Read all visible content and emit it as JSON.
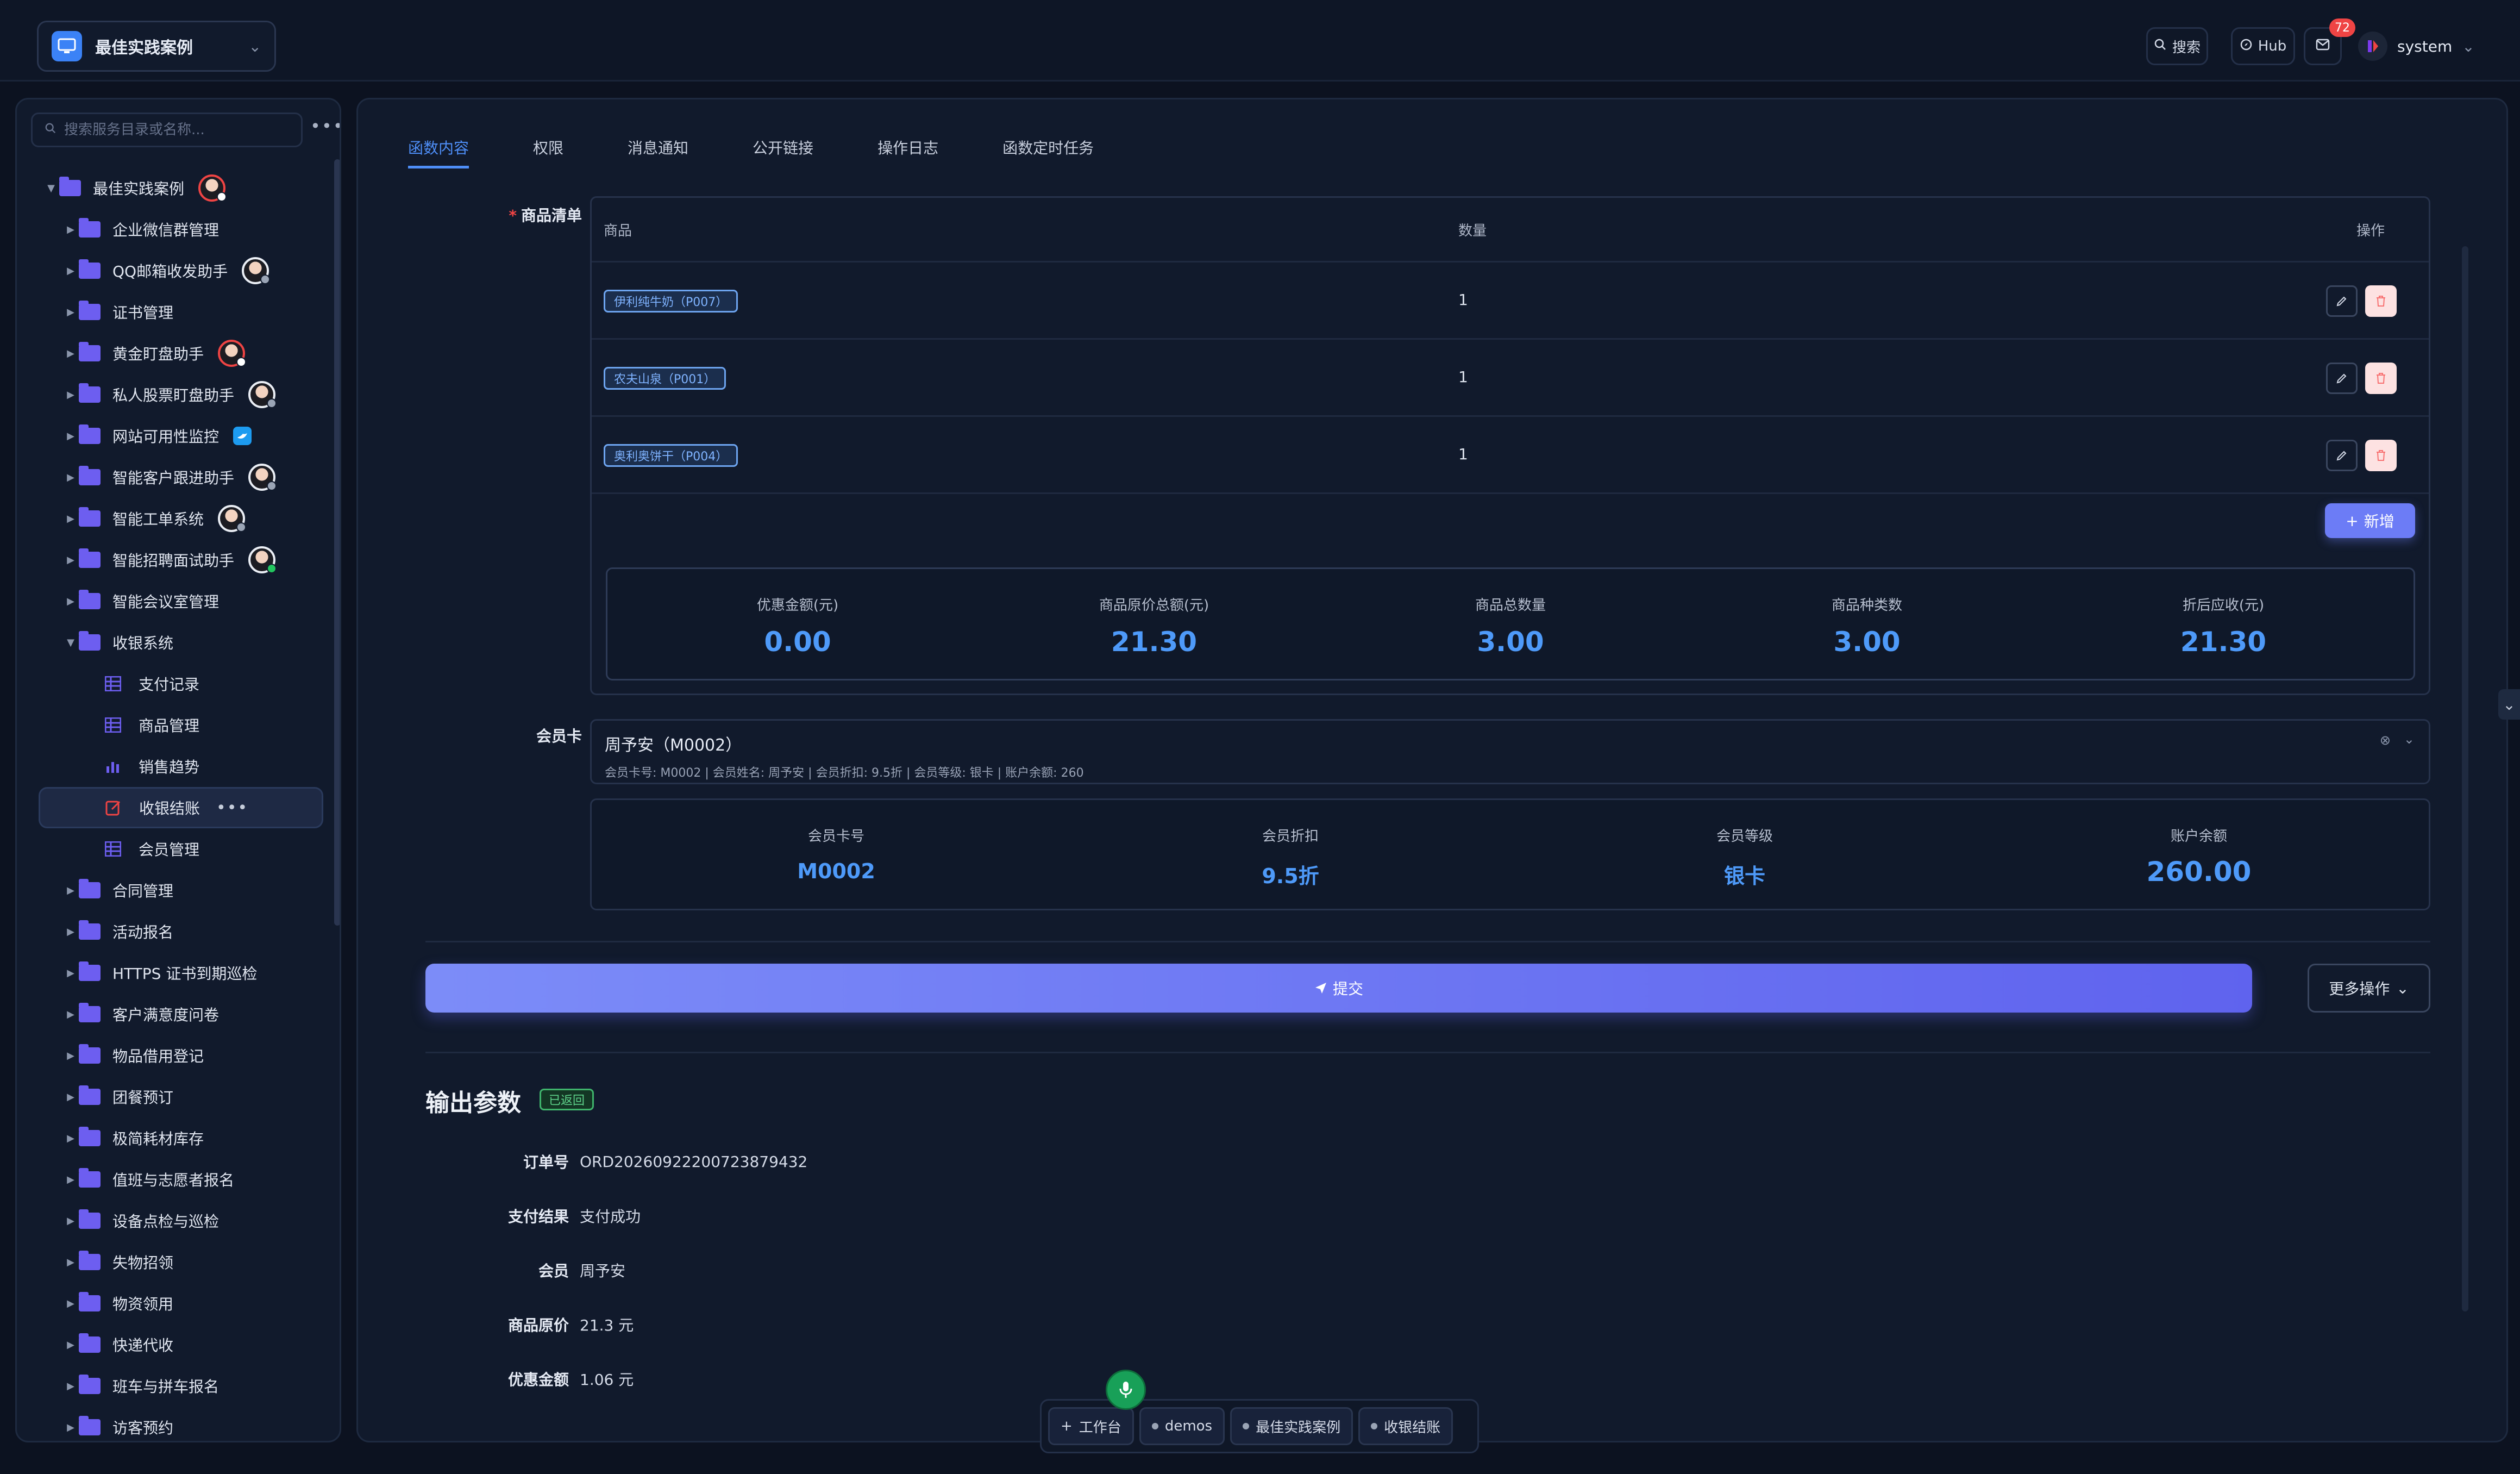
{
  "header": {
    "workspace_name": "最佳实践案例",
    "search_label": "搜索",
    "hub_label": "Hub",
    "notification_count": "72",
    "user_name": "system"
  },
  "sidebar": {
    "search_placeholder": "搜索服务目录或名称...",
    "root": "最佳实践案例",
    "items": [
      {
        "label": "企业微信群管理"
      },
      {
        "label": "QQ邮箱收发助手"
      },
      {
        "label": "证书管理"
      },
      {
        "label": "黄金盯盘助手"
      },
      {
        "label": "私人股票盯盘助手"
      },
      {
        "label": "网站可用性监控"
      },
      {
        "label": "智能客户跟进助手"
      },
      {
        "label": "智能工单系统"
      },
      {
        "label": "智能招聘面试助手"
      },
      {
        "label": "智能会议室管理"
      },
      {
        "label": "收银系统"
      }
    ],
    "children": [
      {
        "label": "支付记录"
      },
      {
        "label": "商品管理"
      },
      {
        "label": "销售趋势"
      },
      {
        "label": "收银结账"
      },
      {
        "label": "会员管理"
      }
    ],
    "items_after": [
      {
        "label": "合同管理"
      },
      {
        "label": "活动报名"
      },
      {
        "label": "HTTPS 证书到期巡检"
      },
      {
        "label": "客户满意度问卷"
      },
      {
        "label": "物品借用登记"
      },
      {
        "label": "团餐预订"
      },
      {
        "label": "极简耗材库存"
      },
      {
        "label": "值班与志愿者报名"
      },
      {
        "label": "设备点检与巡检"
      },
      {
        "label": "失物招领"
      },
      {
        "label": "物资领用"
      },
      {
        "label": "快递代收"
      },
      {
        "label": "班车与拼车报名"
      },
      {
        "label": "访客预约"
      }
    ]
  },
  "tabs": [
    "函数内容",
    "权限",
    "消息通知",
    "公开链接",
    "操作日志",
    "函数定时任务"
  ],
  "form": {
    "goods_label": "商品清单",
    "columns": [
      "商品",
      "数量",
      "操作"
    ],
    "rows": [
      {
        "product": "伊利纯牛奶（P007）",
        "qty": "1"
      },
      {
        "product": "农夫山泉（P001）",
        "qty": "1"
      },
      {
        "product": "奥利奥饼干（P004）",
        "qty": "1"
      }
    ],
    "add_label": "新增",
    "summary": [
      {
        "label": "优惠金额(元)",
        "value": "0.00"
      },
      {
        "label": "商品原价总额(元)",
        "value": "21.30"
      },
      {
        "label": "商品总数量",
        "value": "3.00"
      },
      {
        "label": "商品种类数",
        "value": "3.00"
      },
      {
        "label": "折后应收(元)",
        "value": "21.30"
      }
    ],
    "member_label": "会员卡",
    "member_name": "周予安（M0002）",
    "member_desc": "会员卡号: M0002 | 会员姓名: 周予安 | 会员折扣: 9.5折 | 会员等级: 银卡 | 账户余额: 260",
    "member_stats": [
      {
        "label": "会员卡号",
        "value": "M0002"
      },
      {
        "label": "会员折扣",
        "value": "9.5折"
      },
      {
        "label": "会员等级",
        "value": "银卡"
      },
      {
        "label": "账户余额",
        "value": "260.00"
      }
    ],
    "submit_label": "提交",
    "more_label": "更多操作"
  },
  "output": {
    "title": "输出参数",
    "badge": "已返回",
    "fields": [
      {
        "label": "订单号",
        "value": "ORD20260922200723879432"
      },
      {
        "label": "支付结果",
        "value": "支付成功"
      },
      {
        "label": "会员",
        "value": "周予安"
      },
      {
        "label": "商品原价",
        "value": "21.3 元"
      },
      {
        "label": "优惠金额",
        "value": "1.06 元"
      }
    ]
  },
  "dock": {
    "workbench": "工作台",
    "items": [
      "demos",
      "最佳实践案例",
      "收银结账"
    ]
  },
  "colors": {
    "accent": "#4e8ef7",
    "button": "#6c7cf6",
    "folder": "#6d5ef0",
    "success": "#18a058"
  }
}
